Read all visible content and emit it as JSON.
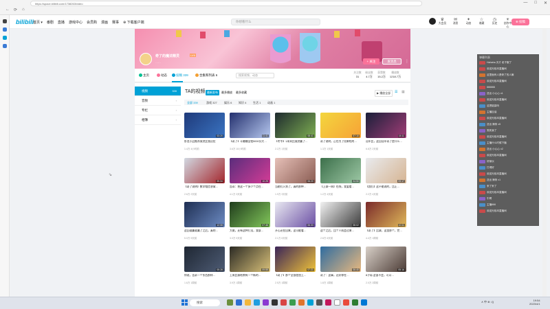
{
  "browser": {
    "tab_title": "奇了的魔法精灵个人空间-奇了的魔法精灵个人主页-哔哩哔哩视频",
    "url": "https://space.bilibili.com/1738263/video",
    "controls": [
      "—",
      "□",
      "✕"
    ]
  },
  "header": {
    "logo": "bilibili",
    "nav": [
      "首页 ▾",
      "番剧",
      "直播",
      "游戏中心",
      "会员购",
      "漫画",
      "赛事",
      "⊕ 下载客户端"
    ],
    "search_placeholder": "你想看什么",
    "right_icons": [
      {
        "icon": "crown-icon",
        "label": "大会员"
      },
      {
        "icon": "message-icon",
        "label": "消息"
      },
      {
        "icon": "dynamic-icon",
        "label": "动态"
      },
      {
        "icon": "star-icon",
        "label": "收藏"
      },
      {
        "icon": "history-icon",
        "label": "历史"
      },
      {
        "icon": "bulb-icon",
        "label": "创作中心"
      }
    ],
    "upload_label": "⊕ 投稿"
  },
  "profile": {
    "name": "奇了的魔法精灵",
    "level": "LV6",
    "sign": "……",
    "follow_label": "+ 关注",
    "message_label": "发消息",
    "more": "⋮",
    "tabs": [
      {
        "label": "主页",
        "icon_color": "#00c091"
      },
      {
        "label": "动态",
        "icon_color": "#fb7299"
      },
      {
        "label": "投稿 339",
        "icon_color": "#00a1d6"
      },
      {
        "label": "合集和列表 6",
        "icon_color": "#f3a034"
      }
    ],
    "search_placeholder": "搜索视频、动态",
    "stats": [
      {
        "label": "关注数",
        "value": "31"
      },
      {
        "label": "粉丝数",
        "value": "4.7万"
      },
      {
        "label": "获赞数",
        "value": "15.2万"
      },
      {
        "label": "播放数",
        "value": "1218.7万"
      }
    ]
  },
  "left_menu": [
    {
      "label": "视频",
      "count": "339"
    },
    {
      "label": "音频",
      "count": ""
    },
    {
      "label": "专栏",
      "count": ""
    },
    {
      "label": "相簿",
      "count": ""
    }
  ],
  "videos_section": {
    "heading": "TA的视频",
    "sort_options": [
      "最新发布",
      "最多播放",
      "最多收藏"
    ],
    "play_all": "▶ 播放全部",
    "filters": [
      "全部 339",
      "游戏 327",
      "娱乐 6",
      "知识 4",
      "生活 1",
      "动画 1"
    ]
  },
  "videos": [
    {
      "title": "卧龙小品推荐竟然比我还拉",
      "views": "1.4万",
      "date": "4小时前",
      "duration": "03:20",
      "colors": [
        "#1f3a7a",
        "#3a74c2"
      ]
    },
    {
      "title": "【奇了】斗蛐蛐全程5000分大…",
      "views": "3.6万",
      "date": "10小时前",
      "duration": "11:41",
      "colors": [
        "#24306e",
        "#b6c8ef"
      ]
    },
    {
      "title": "【冬令】1米米比竟然赢了…",
      "views": "2.2万",
      "date": "1天前",
      "duration": "08:41",
      "colors": [
        "#1e2a2e",
        "#7eae52"
      ]
    },
    {
      "title": "奇了说明，正在为了用来吃的…",
      "views": "1.3万",
      "date": "1天前",
      "duration": "07:10",
      "colors": [
        "#f4d63e",
        "#f6a236"
      ]
    },
    {
      "title": "冠军比，这回冠军奇了是什么…",
      "views": "6.8万",
      "date": "2天前",
      "duration": "15:11",
      "colors": [
        "#1a1f3a",
        "#a13d76"
      ]
    },
    {
      "title": "【奇了说明】数学相信答案…",
      "views": "2.6万",
      "date": "2天前",
      "duration": "05:34",
      "colors": [
        "#d2d9e2",
        "#a4262c"
      ]
    },
    {
      "title": "告诉：把这一个多少个点在…",
      "views": "4.1万",
      "date": "3天前",
      "duration": "10:25",
      "colors": [
        "#5a2d7c",
        "#d43c96"
      ]
    },
    {
      "title": "当她们入到了，真的那种…",
      "views": "1.9万",
      "date": "3天前",
      "duration": "06:20",
      "colors": [
        "#e6c0b8",
        "#8a5c52"
      ]
    },
    {
      "title": "【上赛一周】在线，我爱看…",
      "views": "1.2万",
      "date": "4天前",
      "duration": "04:50",
      "colors": [
        "#3c6f4a",
        "#9dc8a5"
      ]
    },
    {
      "title": "【我们】这不能说的，比正…",
      "views": "2.2万",
      "date": "4天前",
      "duration": "09:17",
      "colors": [
        "#e9ebee",
        "#d6b492"
      ]
    },
    {
      "title": "这回谁赢谁赢了之后，真的…",
      "views": "5.0万",
      "date": "5天前",
      "duration": "12:08",
      "colors": [
        "#1e2e52",
        "#6d8cc4"
      ]
    },
    {
      "title": "大佬，还有这种打法，我该…",
      "views": "3.3万",
      "date": "5天前",
      "duration": "07:46",
      "colors": [
        "#1f3c1c",
        "#82c75a"
      ]
    },
    {
      "title": "开心还在回来，这可能看…",
      "views": "2.1万",
      "date": "6天前",
      "duration": "06:33",
      "colors": [
        "#e9e9f1",
        "#6a4ea4"
      ]
    },
    {
      "title": "这个之后，比个人机会过来…",
      "views": "2.8万",
      "date": "6天前",
      "duration": "08:02",
      "colors": [
        "#f2f2f2",
        "#3b3b3b"
      ]
    },
    {
      "title": "【奇了】比赛，这里那个，完…",
      "views": "4.4万",
      "date": "1周前",
      "duration": "10:11",
      "colors": [
        "#7a2a2a",
        "#e0b95a"
      ]
    },
    {
      "title": "你说，告诉一个东西那样…",
      "views": "1.6万",
      "date": "1周前",
      "duration": "05:28",
      "colors": [
        "#1f2733",
        "#4e5c75"
      ]
    },
    {
      "title": "上周比赛结束有一个新的…",
      "views": "3.9万",
      "date": "1周前",
      "duration": "09:55",
      "colors": [
        "#2b2a24",
        "#d9c179"
      ]
    },
    {
      "title": "【奇了】那个全部是加上…",
      "views": "2.5万",
      "date": "1周前",
      "duration": "07:21",
      "colors": [
        "#3a2458",
        "#f0c33a"
      ]
    },
    {
      "title": "奇了：这事，还好你在…",
      "views": "1.8万",
      "date": "1周前",
      "duration": "06:40",
      "colors": [
        "#2f6ca0",
        "#e8b87f"
      ]
    },
    {
      "title": "8子局 这该不会，可以…",
      "views": "2.0万",
      "date": "2周前",
      "duration": "05:16",
      "colors": [
        "#d8d0c8",
        "#4a3a34"
      ]
    }
  ],
  "chat": {
    "title": "弹幕列表",
    "rows": [
      {
        "badge": "#c94a4a",
        "text": "Hahaha 天才 老子服了"
      },
      {
        "badge": "#c94a4a",
        "text": "欢迎光临本直播间"
      },
      {
        "badge": "#d3732f",
        "text": "这里面有人是奇了的人嘛"
      },
      {
        "badge": "#c94a4a",
        "text": "欢迎光临本直播间"
      },
      {
        "badge": "#c94a4a",
        "text": "666666"
      },
      {
        "badge": "#8a63c8",
        "text": "送出 小心心 x1"
      },
      {
        "badge": "#c94a4a",
        "text": "欢迎光临本直播间"
      },
      {
        "badge": "#4a8fc9",
        "text": "这把能赢吗"
      },
      {
        "badge": "#d3732f",
        "text": "主播加油"
      },
      {
        "badge": "#c94a4a",
        "text": "欢迎光临本直播间"
      },
      {
        "badge": "#4a8fc9",
        "text": "送出 辣条 x5"
      },
      {
        "badge": "#8a63c8",
        "text": "笑死我了"
      },
      {
        "badge": "#c94a4a",
        "text": "欢迎光临本直播间"
      },
      {
        "badge": "#4a8fc9",
        "text": "主播什么时候下播"
      },
      {
        "badge": "#d3732f",
        "text": "送出 小心心 x2"
      },
      {
        "badge": "#c94a4a",
        "text": "欢迎光临本直播间"
      },
      {
        "badge": "#8a63c8",
        "text": "好家伙"
      },
      {
        "badge": "#4a8fc9",
        "text": "打得好"
      },
      {
        "badge": "#c94a4a",
        "text": "欢迎光临本直播间"
      },
      {
        "badge": "#d3732f",
        "text": "送出 辣条 x1"
      },
      {
        "badge": "#4a8fc9",
        "text": "来了来了"
      },
      {
        "badge": "#c94a4a",
        "text": "欢迎光临本直播间"
      },
      {
        "badge": "#8a63c8",
        "text": "牛啊"
      },
      {
        "badge": "#4a8fc9",
        "text": "主播666"
      },
      {
        "badge": "#c94a4a",
        "text": "欢迎光临本直播间"
      }
    ]
  },
  "taskbar": {
    "search_label": "搜索",
    "tray": "∧ 中 ⊕ ◁)",
    "time": "19:54",
    "date": "2023/4/1"
  }
}
